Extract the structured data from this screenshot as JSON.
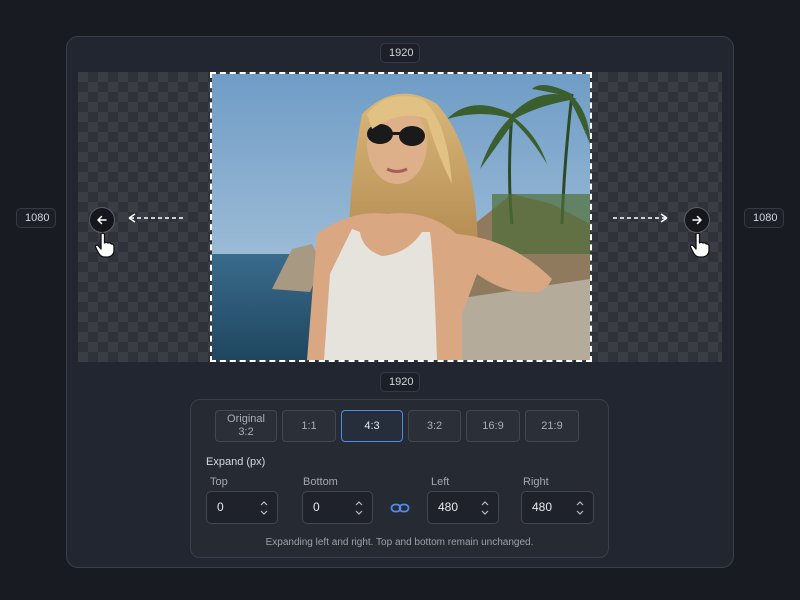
{
  "canvas": {
    "top_width_label": "1920",
    "bottom_width_label": "1920",
    "left_height_label": "1080",
    "right_height_label": "1080"
  },
  "ratios": [
    {
      "label_line1": "Original",
      "label_line2": "3:2",
      "active": false
    },
    {
      "label_line1": "1:1",
      "label_line2": "",
      "active": false
    },
    {
      "label_line1": "4:3",
      "label_line2": "",
      "active": true
    },
    {
      "label_line1": "3:2",
      "label_line2": "",
      "active": false
    },
    {
      "label_line1": "16:9",
      "label_line2": "",
      "active": false
    },
    {
      "label_line1": "21:9",
      "label_line2": "",
      "active": false
    }
  ],
  "expand": {
    "title": "Expand (px)",
    "top": {
      "label": "Top",
      "value": "0"
    },
    "bottom": {
      "label": "Bottom",
      "value": "0"
    },
    "left": {
      "label": "Left",
      "value": "480"
    },
    "right": {
      "label": "Right",
      "value": "480"
    },
    "help": "Expanding left and right. Top and bottom remain unchanged."
  },
  "icons": {
    "left_arrow": "arrow-left-icon",
    "right_arrow": "arrow-right-icon",
    "link": "link-icon",
    "cursor": "hand-pointer-icon"
  },
  "colors": {
    "accent": "#4e8ce8",
    "background": "#181b22",
    "panel": "#222630"
  }
}
